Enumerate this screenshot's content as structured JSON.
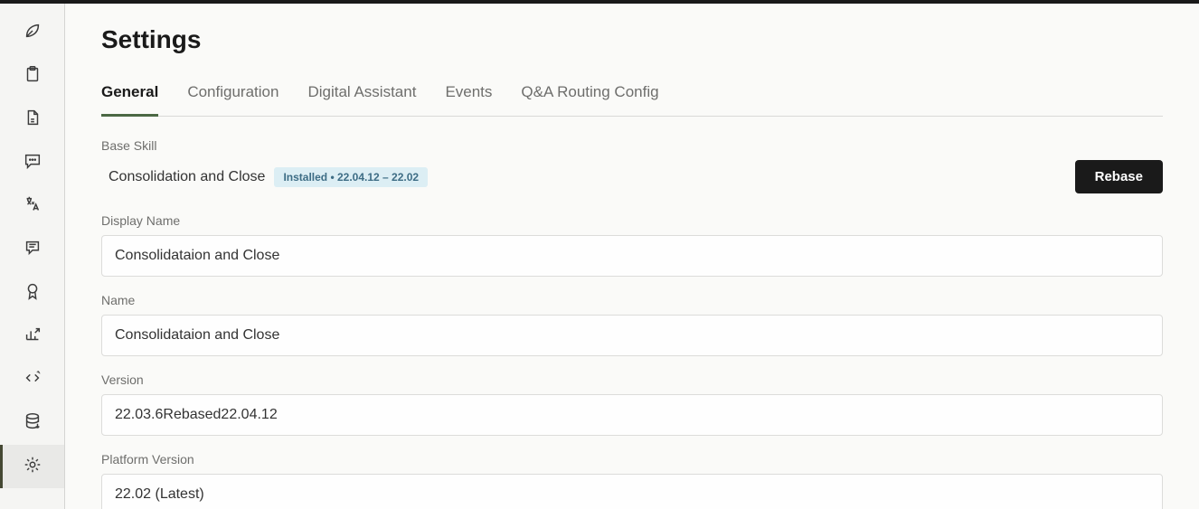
{
  "page": {
    "title": "Settings"
  },
  "tabs": [
    {
      "label": "General",
      "active": true
    },
    {
      "label": "Configuration",
      "active": false
    },
    {
      "label": "Digital Assistant",
      "active": false
    },
    {
      "label": "Events",
      "active": false
    },
    {
      "label": "Q&A Routing Config",
      "active": false
    }
  ],
  "baseSkill": {
    "label": "Base Skill",
    "name": "Consolidation and Close",
    "badge": "Installed • 22.04.12 – 22.02",
    "rebase": "Rebase"
  },
  "fields": {
    "displayName": {
      "label": "Display Name",
      "value": "Consolidataion and Close"
    },
    "name": {
      "label": "Name",
      "value": "Consolidataion and Close"
    },
    "version": {
      "label": "Version",
      "value": "22.03.6Rebased22.04.12"
    },
    "platform": {
      "label": "Platform Version",
      "value": "22.02 (Latest)"
    }
  },
  "sidebar": {
    "items": [
      {
        "name": "leaf-icon"
      },
      {
        "name": "clipboard-icon"
      },
      {
        "name": "file-icon"
      },
      {
        "name": "chat-icon"
      },
      {
        "name": "translate-icon"
      },
      {
        "name": "dialog-icon"
      },
      {
        "name": "ribbon-icon"
      },
      {
        "name": "chart-icon"
      },
      {
        "name": "code-icon"
      },
      {
        "name": "database-icon"
      },
      {
        "name": "settings-icon",
        "active": true
      }
    ]
  }
}
